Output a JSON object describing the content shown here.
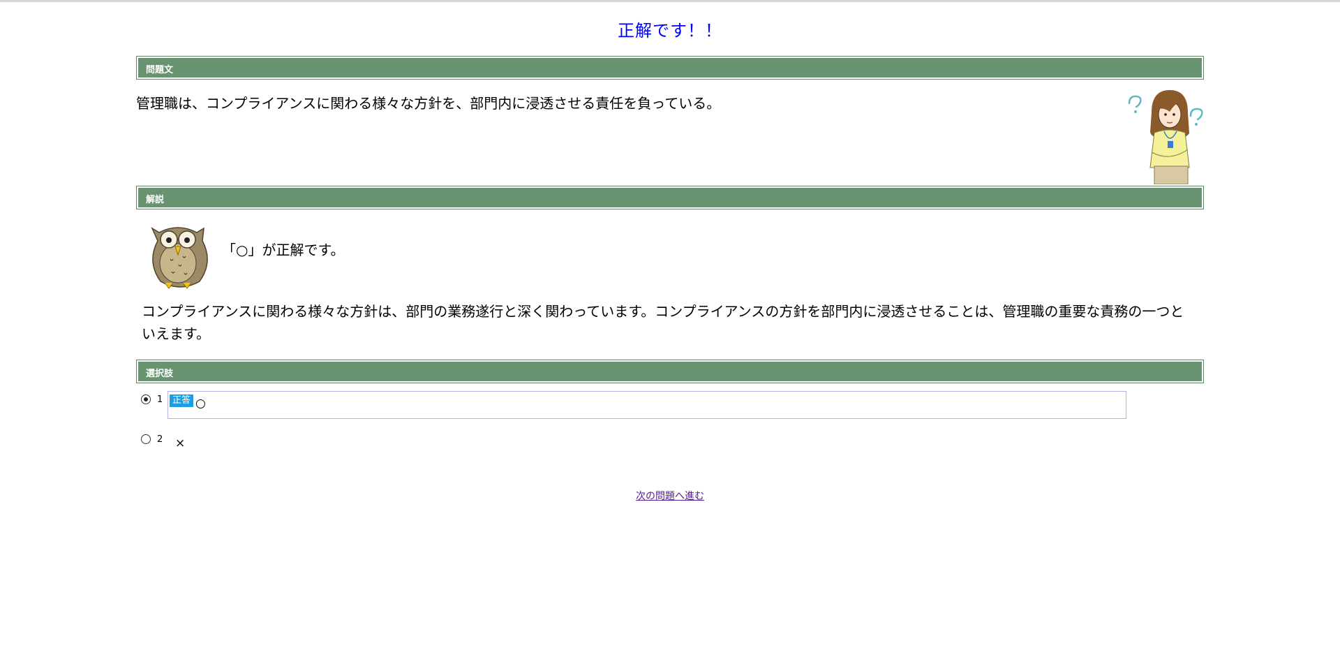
{
  "result": {
    "title": "正解です！！"
  },
  "sections": {
    "question": "問題文",
    "explanation": "解説",
    "choices": "選択肢"
  },
  "question": {
    "text": "管理職は、コンプライアンスに関わる様々な方針を、部門内に浸透させる責任を負っている。"
  },
  "explanation": {
    "answer_line": "「○」が正解です。",
    "body": "コンプライアンスに関わる様々な方針は、部門の業務遂行と深く関わっています。コンプライアンスの方針を部門内に浸透させることは、管理職の重要な責務の一つといえます。"
  },
  "choices": [
    {
      "number": "1",
      "badge": "正答",
      "text": "○",
      "selected": true
    },
    {
      "number": "2",
      "text": "×",
      "selected": false
    }
  ],
  "next": {
    "label": "次の問題へ進む"
  },
  "colors": {
    "section_bar": "#679370",
    "title": "#0000ff",
    "badge": "#1d9ee0",
    "link": "#551a8b"
  }
}
